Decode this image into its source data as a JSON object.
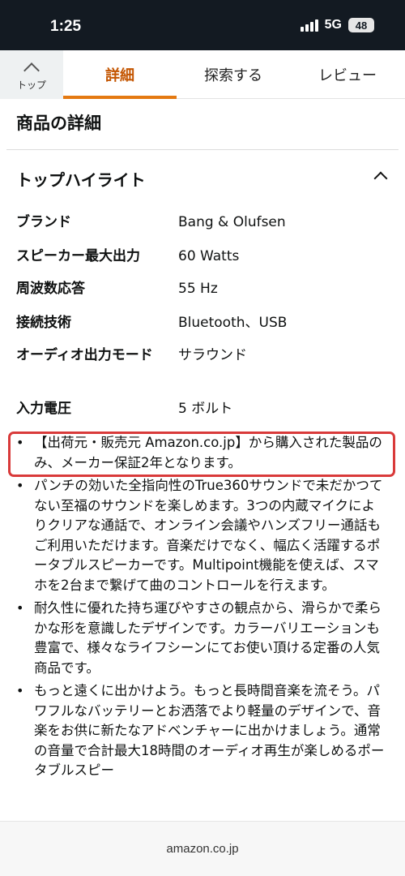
{
  "status": {
    "time": "1:25",
    "network": "5G",
    "battery": "48"
  },
  "tabs": {
    "top_label": "トップ",
    "items": [
      {
        "label": "詳細",
        "active": true
      },
      {
        "label": "探索する",
        "active": false
      },
      {
        "label": "レビュー",
        "active": false
      }
    ]
  },
  "section": {
    "title": "商品の詳細"
  },
  "highlights": {
    "title": "トップハイライト",
    "specs": [
      {
        "key": "ブランド",
        "value": "Bang & Olufsen"
      },
      {
        "key": "スピーカー最大出力",
        "value": "60 Watts"
      },
      {
        "key": "周波数応答",
        "value": "55 Hz"
      },
      {
        "key": "接続技術",
        "value": "Bluetooth、USB"
      },
      {
        "key": "オーディオ出力モード",
        "value": "サラウンド"
      },
      {
        "key": "入力電圧",
        "value": "5 ボルト"
      }
    ]
  },
  "bullets": [
    "【出荷元・販売元 Amazon.co.jp】から購入された製品のみ、メーカー保証2年となります。",
    "パンチの効いた全指向性のTrue360サウンドで未だかつてない至福のサウンドを楽しめます。3つの内蔵マイクによりクリアな通話で、オンライン会議やハンズフリー通話もご利用いただけます。音楽だけでなく、幅広く活躍するポータブルスピーカーです。Multipoint機能を使えば、スマホを2台まで繋げて曲のコントロールを行えます。",
    "耐久性に優れた持ち運びやすさの観点から、滑らかで柔らかな形を意識したデザインです。カラーバリエーションも豊富で、様々なライフシーンにてお使い頂ける定番の人気商品です。",
    "もっと遠くに出かけよう。もっと長時間音楽を流そう。パワフルなバッテリーとお洒落でより軽量のデザインで、音楽をお供に新たなアドベンチャーに出かけましょう。通常の音量で合計最大18時間のオーディオ再生が楽しめるポータブルスピー"
  ],
  "footer": {
    "domain": "amazon.co.jp"
  },
  "colors": {
    "accent": "#e47911",
    "active_tab_text": "#c45500",
    "highlight_border": "#d93a3a",
    "status_bar": "#131a22"
  }
}
